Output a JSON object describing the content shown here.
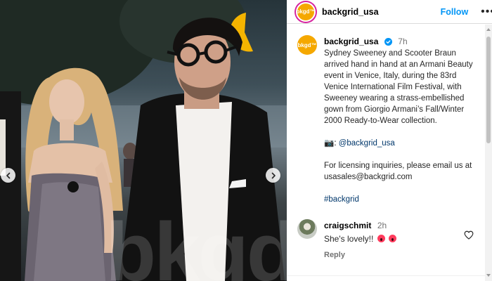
{
  "post": {
    "username": "backgrid_usa",
    "avatar_text": "bkgd™",
    "follow_label": "Follow",
    "more_icon": "more-horizontal-icon",
    "caption_time": "7h",
    "caption_text": "Sydney Sweeney and Scooter Braun arrived hand in hand at an Armani Beauty event in Venice, Italy, during the 83rd Venice International Film Festival, with Sweeney wearing a strass-embellished gown from Giorgio Armani’s Fall/Winter 2000 Ready-to-Wear collection.",
    "camera_emoji": "📷:",
    "credit_mention": "@backgrid_usa",
    "licensing_text": "For licensing inquiries, please email us at usasales@backgrid.com",
    "hashtag": "#backgrid"
  },
  "media": {
    "watermark": "bkgd",
    "prev_icon": "chevron-left-icon",
    "next_icon": "chevron-right-icon"
  },
  "comment": {
    "username": "craigschmit",
    "time": "2h",
    "text": "She's lovely!!",
    "reply_label": "Reply",
    "like_icon": "heart-outline-icon"
  },
  "colors": {
    "accent": "#0095f6",
    "brand": "#f5a800",
    "link": "#00376b",
    "muted": "#737373"
  }
}
